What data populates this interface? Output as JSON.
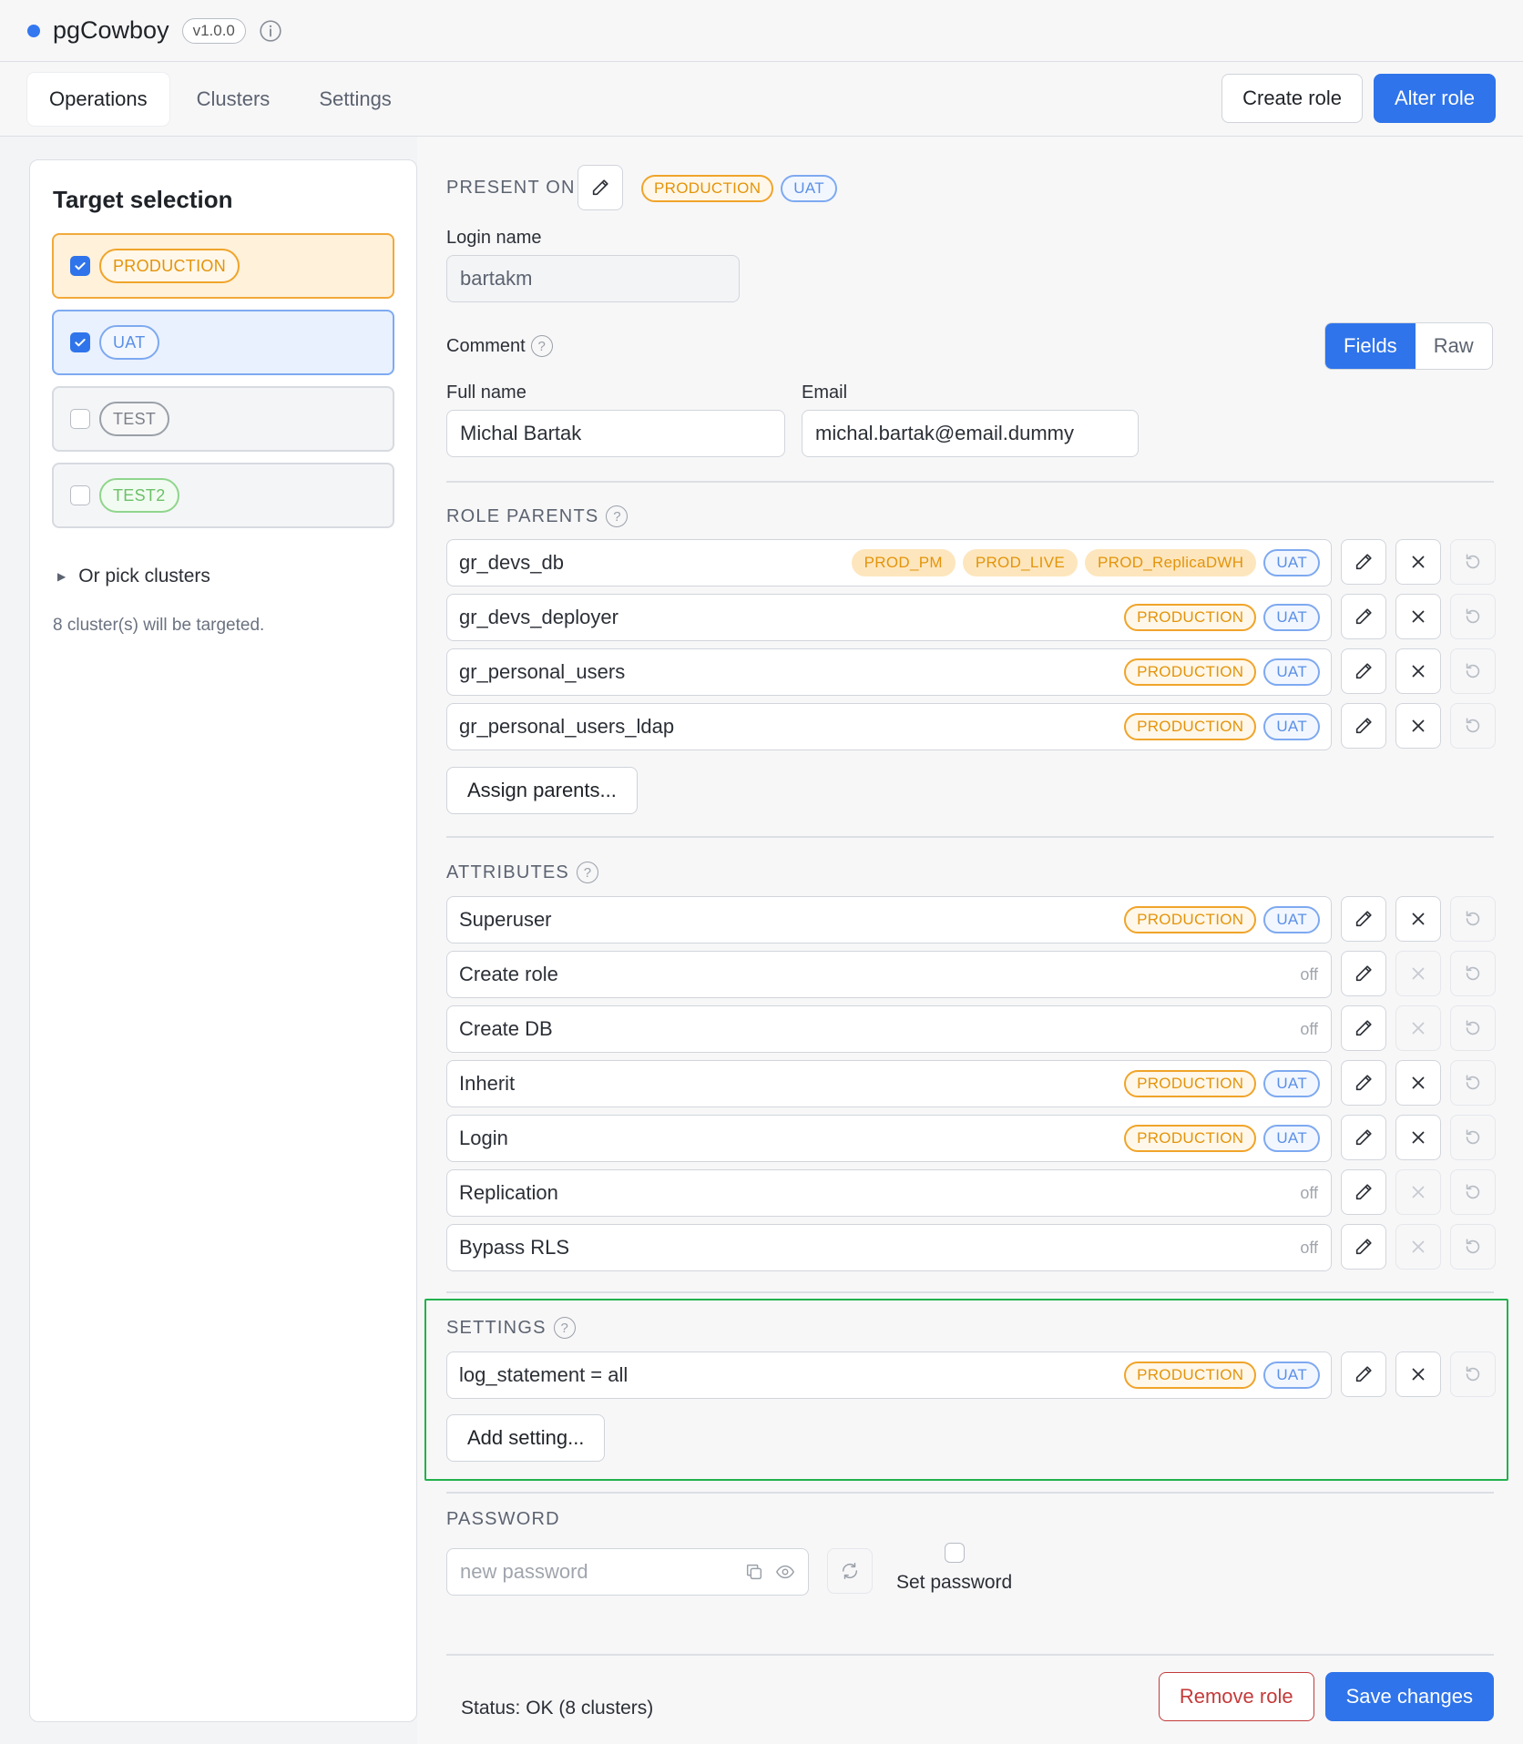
{
  "app": {
    "title": "pgCowboy",
    "version": "v1.0.0"
  },
  "nav": {
    "tabs": [
      {
        "label": "Operations",
        "active": true
      },
      {
        "label": "Clusters",
        "active": false
      },
      {
        "label": "Settings",
        "active": false
      }
    ],
    "create_role_label": "Create role",
    "alter_role_label": "Alter role"
  },
  "sidebar": {
    "title": "Target selection",
    "targets": [
      {
        "label": "PRODUCTION",
        "checked": true
      },
      {
        "label": "UAT",
        "checked": true
      },
      {
        "label": "TEST",
        "checked": false
      },
      {
        "label": "TEST2",
        "checked": false
      }
    ],
    "pick_clusters_label": "Or pick clusters",
    "target_count_text": "8 cluster(s) will be targeted."
  },
  "present_on": {
    "label": "PRESENT ON",
    "tags": [
      "PRODUCTION",
      "UAT"
    ]
  },
  "login": {
    "label": "Login name",
    "value": "bartakm"
  },
  "comment": {
    "label": "Comment",
    "mode_fields": "Fields",
    "mode_raw": "Raw",
    "full_name_label": "Full name",
    "full_name_value": "Michal Bartak",
    "email_label": "Email",
    "email_value": "michal.bartak@email.dummy"
  },
  "role_parents": {
    "label": "ROLE PARENTS",
    "items": [
      {
        "name": "gr_devs_db",
        "tags": [
          "PROD_PM",
          "PROD_LIVE",
          "PROD_ReplicaDWH"
        ],
        "uat": "UAT"
      },
      {
        "name": "gr_devs_deployer",
        "tags": [
          "PRODUCTION"
        ],
        "uat": "UAT"
      },
      {
        "name": "gr_personal_users",
        "tags": [
          "PRODUCTION"
        ],
        "uat": "UAT"
      },
      {
        "name": "gr_personal_users_ldap",
        "tags": [
          "PRODUCTION"
        ],
        "uat": "UAT"
      }
    ],
    "assign_label": "Assign parents..."
  },
  "attributes": {
    "label": "ATTRIBUTES",
    "off_text": "off",
    "items": [
      {
        "name": "Superuser",
        "on": true,
        "prod": "PRODUCTION",
        "uat": "UAT"
      },
      {
        "name": "Create role",
        "on": false
      },
      {
        "name": "Create DB",
        "on": false
      },
      {
        "name": "Inherit",
        "on": true,
        "prod": "PRODUCTION",
        "uat": "UAT"
      },
      {
        "name": "Login",
        "on": true,
        "prod": "PRODUCTION",
        "uat": "UAT"
      },
      {
        "name": "Replication",
        "on": false
      },
      {
        "name": "Bypass RLS",
        "on": false
      }
    ]
  },
  "settings": {
    "label": "SETTINGS",
    "items": [
      {
        "name": "log_statement = all",
        "prod": "PRODUCTION",
        "uat": "UAT"
      }
    ],
    "add_label": "Add setting..."
  },
  "password": {
    "label": "PASSWORD",
    "placeholder": "new password",
    "set_password_label": "Set password"
  },
  "footer": {
    "status_text": "Status: OK (8 clusters)",
    "remove_label": "Remove role",
    "save_label": "Save changes"
  },
  "colors": {
    "accent": "#2f74ea",
    "production": "#e3940b",
    "uat": "#5b8fe6",
    "danger": "#c43a3a",
    "highlight": "#22b14c"
  }
}
